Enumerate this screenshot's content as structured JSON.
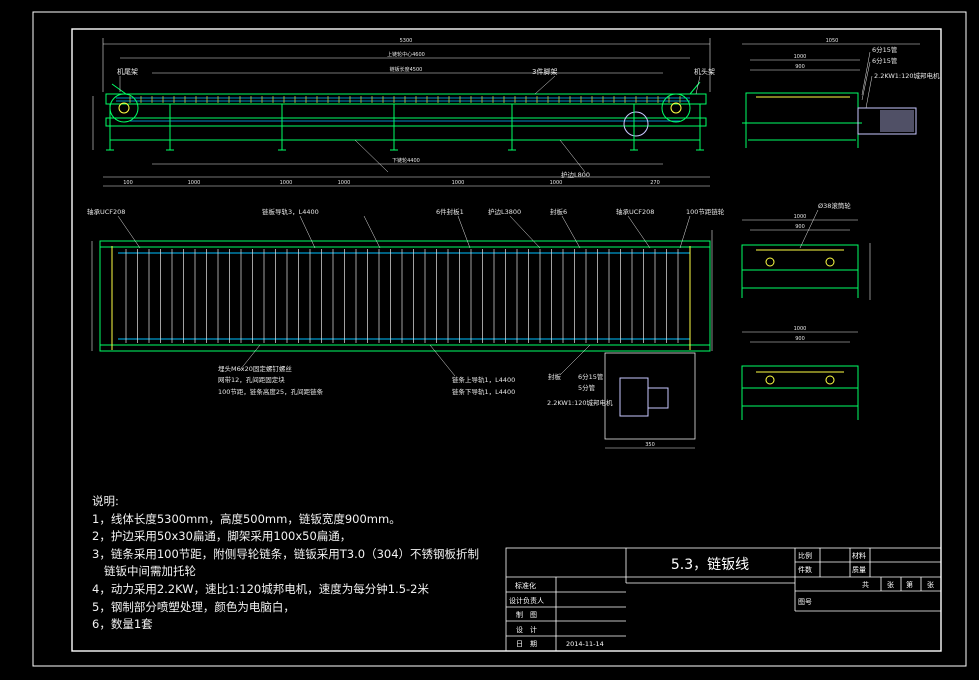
{
  "drawing": {
    "colors": {
      "background": "#000000",
      "frame": "#ffffff",
      "structure": "#00ff66",
      "chain": "#00bfff",
      "dimension": "#e6e6e6",
      "motor": "#c8c8ff",
      "accent": "#ffff44"
    }
  },
  "side_view": {
    "labels": {
      "tail_frame": "机尾架",
      "head_frame": "机头架",
      "leg_frame": "3件脚架",
      "guard_rail": "护边L800"
    }
  },
  "plan_view": {
    "labels": {
      "bearing_ucf208_left": "轴承UCF208",
      "chain_guide_rail": "链板导轨3，L4400",
      "sealing_plate": "6件封板1",
      "rail_l3800": "护边L3800",
      "seal_plate_6": "封板6",
      "bearing_ucf208_right": "轴承UCF208",
      "sprocket_100": "100节距链轮",
      "bolt_note": "埋头M6x20固定螺钉螺丝",
      "mesh_note": "网带12，孔间距固定块",
      "chain_note": "100节距，链条高度25，孔间距链条",
      "upper_rail": "链条上导轨1，L4400",
      "lower_rail": "链条下导轨1，L4400",
      "seal_plate": "封板",
      "pipe_6": "6分15管",
      "pipe_5": "5分管",
      "motor": "2.2KW1:120城邦电机"
    }
  },
  "end_view": {
    "labels": {
      "pipe_6": "6分15管",
      "pipe_5": "6分15管",
      "motor": "2.2KW1:120城邦电机"
    }
  },
  "section_view": {
    "labels": {
      "roller": "Ø38滚筒轮"
    }
  },
  "notes": {
    "heading": "说明:",
    "items": [
      "1，线体长度5300mm，高度500mm，链钣宽度900mm。",
      "2，护边采用50x30扁通，脚架采用100x50扁通，",
      "3，链条采用100节距，附侧导轮链条，链钣采用T3.0（304）不锈钢板折制",
      "链钣中间需加托轮",
      "4，动力采用2.2KW，速比1:120城邦电机，速度为每分钟1.5-2米",
      "5，钢制部分喷塑处理，颜色为电脑白，",
      "6，数量1套"
    ]
  },
  "title_block": {
    "title": "5.3，链钣线",
    "scale_label": "比例",
    "material_label": "材料",
    "count_label": "件数",
    "quality_label": "质量",
    "total_label": "共",
    "sheets_label": "张",
    "sheet_no_label": "第",
    "sheet_unit_label": "张",
    "drawing_no_label": "图号",
    "std_label": "标准化",
    "designer_lead_label": "设计负责人",
    "drafter_label": "制　图",
    "design_label": "设　计",
    "date_label": "日　期",
    "date_value": "2014-11-14"
  }
}
